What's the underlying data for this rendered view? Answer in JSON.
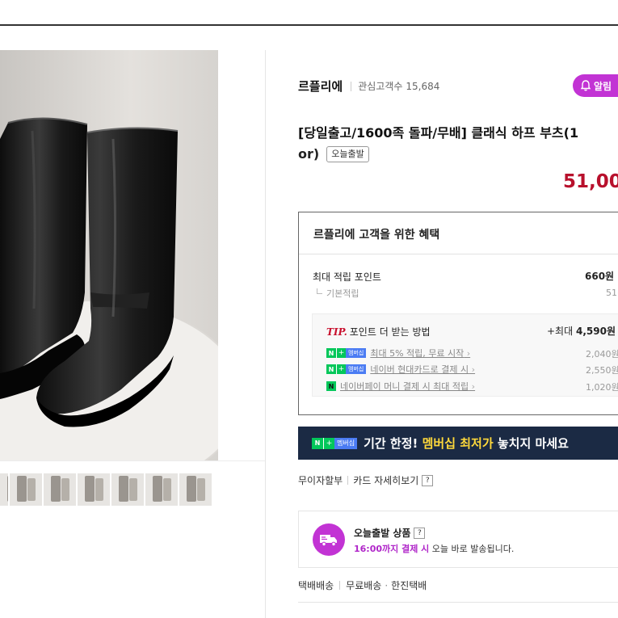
{
  "seller": {
    "name": "르플리에",
    "fans_label": "관심고객수",
    "fans_count": "15,684",
    "alarm_label": "알림"
  },
  "product": {
    "title_line1": "[당일출고/1600족 돌파/무배] 클래식 하프 부츠(1",
    "title_line2": "or)",
    "today_badge": "오늘출발",
    "price": "51,00"
  },
  "benefit": {
    "title": "르플리에 고객을 위한 혜택",
    "max_points_label": "최대 적립 포인트",
    "max_points_value": "660원",
    "base_label": "기본적립",
    "base_value": "51(",
    "tip_word": "TIP.",
    "tip_heading": "포인트 더 받는 방법",
    "tip_max_prefix": "+최대",
    "tip_max_value": "4,590",
    "tip_max_unit": "원",
    "rows": [
      {
        "badge": "membership",
        "text": "최대 5% 적립, 무료 시작",
        "amount": "2,040원"
      },
      {
        "badge": "membership",
        "text": "네이버 현대카드로 결제 시",
        "amount": "2,550원"
      },
      {
        "badge": "npay",
        "text": "네이버페이 머니 결제 시 최대 적립",
        "amount": "1,020원"
      }
    ]
  },
  "badges": {
    "n": "N",
    "plus": "+",
    "membership": "멤버십"
  },
  "banner": {
    "text_prefix": "기간 한정!",
    "text_highlight": "멤버십 최저가",
    "text_suffix": "놓치지 마세요"
  },
  "card": {
    "installment": "무이자할부",
    "card_detail": "카드 자세히보기",
    "help": "?"
  },
  "shipping": {
    "title": "오늘출발 상품",
    "deadline": "16:00까지 결제 시",
    "desc": "오늘 바로 발송됩니다."
  },
  "delivery": {
    "type": "택배배송",
    "fee": "무료배송",
    "carrier": "한진택배"
  },
  "colors": {
    "accent": "#c233d4",
    "price": "#b8102c",
    "naver_green": "#03c75a",
    "banner_bg": "#1b2a44"
  }
}
